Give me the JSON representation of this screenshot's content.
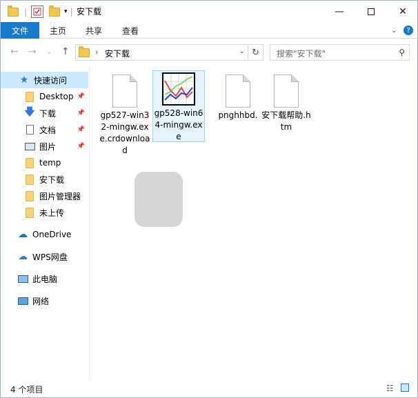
{
  "window": {
    "title": "安下载"
  },
  "ribbon": {
    "file_tab": "文件",
    "tabs": [
      "主页",
      "共享",
      "查看"
    ]
  },
  "address": {
    "path": "安下载",
    "search_placeholder": "搜索\"安下载\""
  },
  "sidebar": {
    "items": [
      {
        "label": "快速访问",
        "icon": "star-icon",
        "pinned": false
      },
      {
        "label": "Desktop",
        "icon": "folder-icon",
        "pinned": true
      },
      {
        "label": "下载",
        "icon": "download-arrow-icon",
        "pinned": true
      },
      {
        "label": "文档",
        "icon": "document-icon",
        "pinned": true
      },
      {
        "label": "图片",
        "icon": "picture-icon",
        "pinned": true
      },
      {
        "label": "temp",
        "icon": "folder-icon",
        "pinned": false
      },
      {
        "label": "安下载",
        "icon": "folder-icon",
        "pinned": false
      },
      {
        "label": "图片管理器",
        "icon": "folder-icon",
        "pinned": false
      },
      {
        "label": "未上传",
        "icon": "folder-icon",
        "pinned": false
      },
      {
        "label": "OneDrive",
        "icon": "cloud-icon",
        "pinned": false
      },
      {
        "label": "WPS网盘",
        "icon": "cloud-icon",
        "pinned": false
      },
      {
        "label": "此电脑",
        "icon": "computer-icon",
        "pinned": false
      },
      {
        "label": "网络",
        "icon": "network-icon",
        "pinned": false
      }
    ]
  },
  "files": [
    {
      "name": "gp527-win32-mingw.exe.crdownload",
      "icon": "blank-file-icon"
    },
    {
      "name": "gp528-win64-mingw.exe",
      "icon": "gnuplot-chart-icon"
    },
    {
      "name": "pnghhbd.",
      "icon": "blank-file-icon"
    },
    {
      "name": "安下载帮助.htm",
      "icon": "blank-file-icon"
    }
  ],
  "status": {
    "item_count": "4 个项目"
  },
  "colors": {
    "accent": "#1979ca",
    "selection": "#cce8ff"
  }
}
